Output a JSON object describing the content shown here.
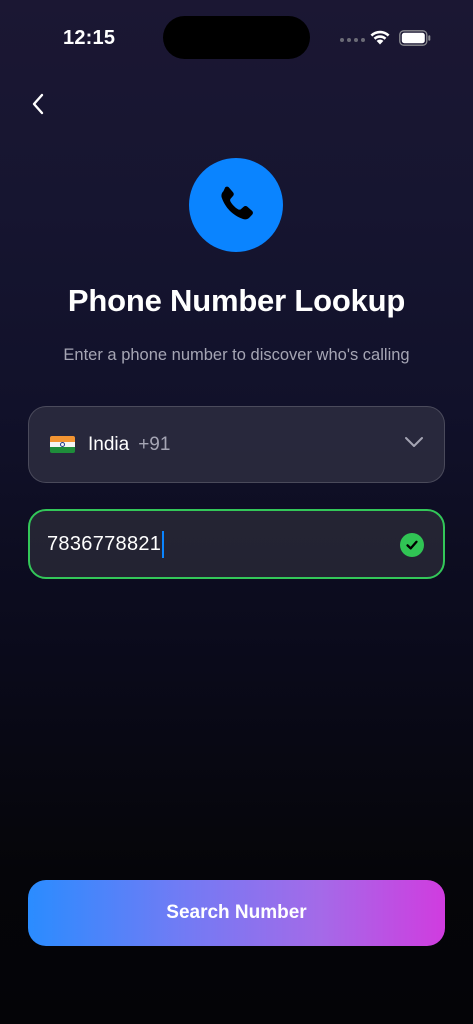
{
  "status_bar": {
    "time": "12:15"
  },
  "navigation": {
    "back_icon": "chevron-left-icon"
  },
  "hero": {
    "icon": "phone-icon",
    "icon_color": "#0a84ff",
    "title": "Phone Number Lookup",
    "subtitle": "Enter a phone number to discover who's calling"
  },
  "country_select": {
    "flag": "india-flag-icon",
    "country": "India",
    "dial_code": "+91",
    "icon": "chevron-down-icon"
  },
  "phone_input": {
    "value": "7836778821",
    "valid": true,
    "valid_color": "#33c759",
    "status_icon": "check-circle-icon"
  },
  "search_button": {
    "label": "Search Number",
    "gradient": [
      "#2a8cff",
      "#d03cdf"
    ]
  }
}
